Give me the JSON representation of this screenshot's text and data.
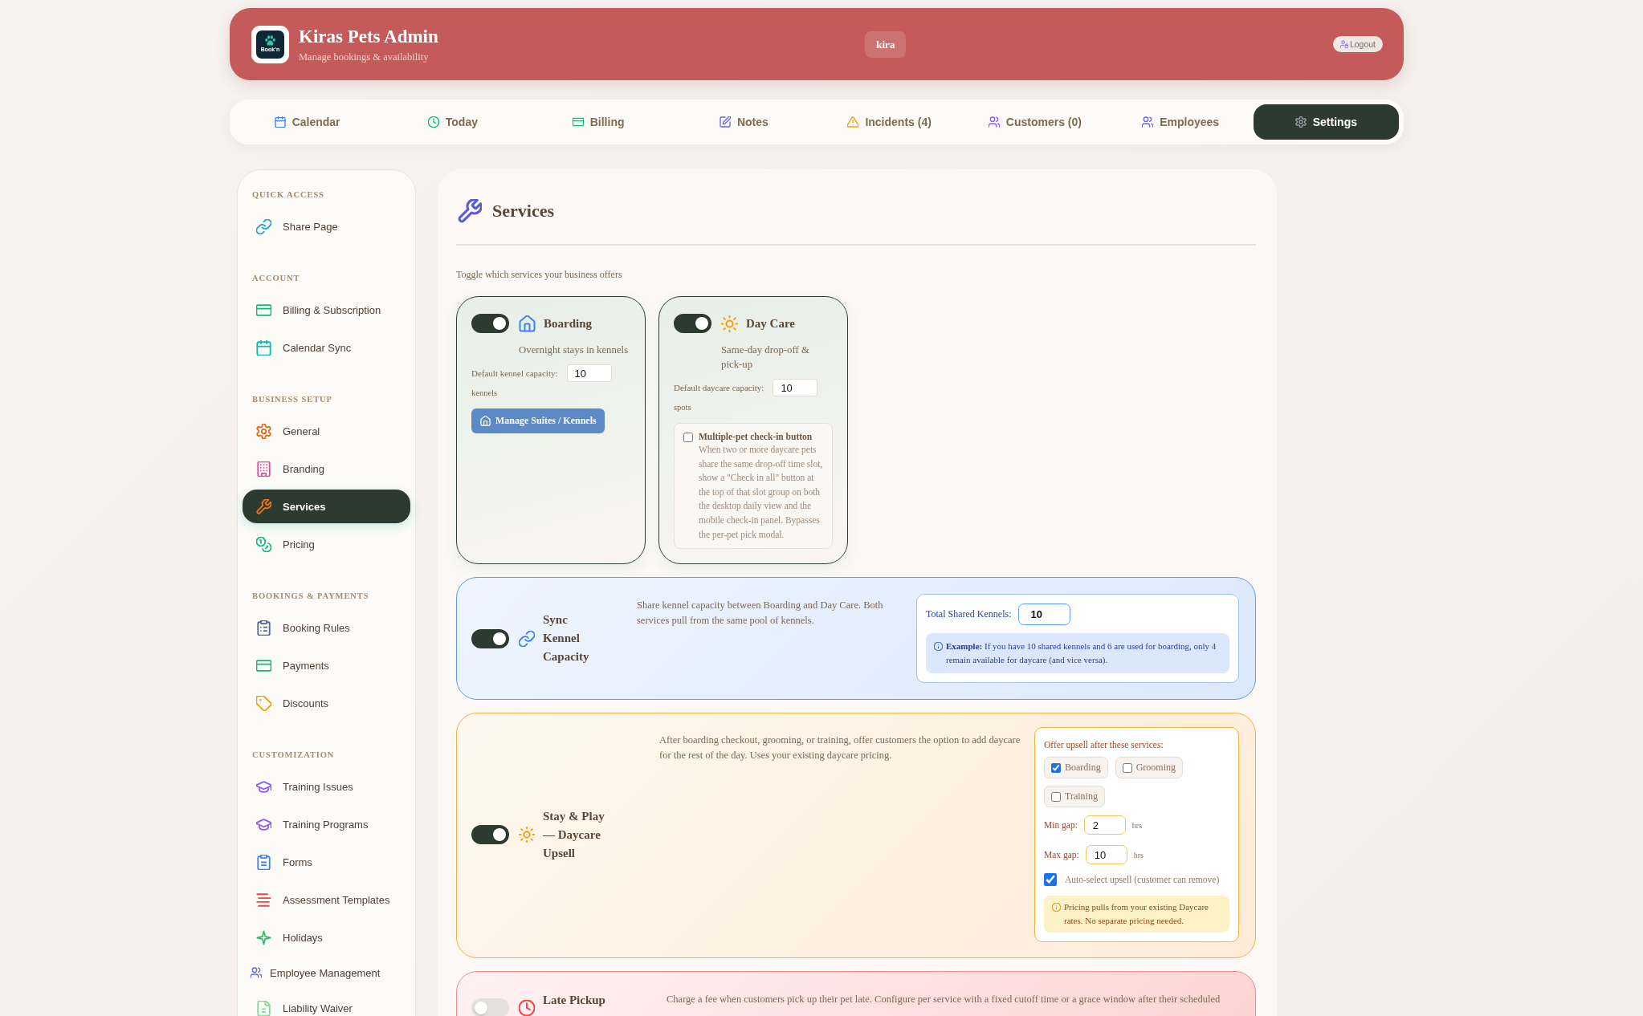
{
  "header": {
    "logo_text": "Book'n",
    "title": "Kiras Pets Admin",
    "subtitle": "Manage bookings & availability",
    "user": "kira",
    "logout": "Logout"
  },
  "nav": [
    {
      "label": "Calendar",
      "selected": false
    },
    {
      "label": "Today",
      "selected": false
    },
    {
      "label": "Billing",
      "selected": false
    },
    {
      "label": "Notes",
      "selected": false
    },
    {
      "label": "Incidents (4)",
      "selected": false
    },
    {
      "label": "Customers (0)",
      "selected": false
    },
    {
      "label": "Employees",
      "selected": false
    },
    {
      "label": "Settings",
      "selected": true
    }
  ],
  "sidebar": {
    "sections": [
      {
        "heading": "QUICK ACCESS",
        "items": [
          {
            "label": "Share Page",
            "kind": "link",
            "selected": false
          }
        ]
      },
      {
        "heading": "ACCOUNT",
        "items": [
          {
            "label": "Billing & Subscription",
            "kind": "link",
            "selected": false
          },
          {
            "label": "Calendar Sync",
            "kind": "link",
            "selected": false
          }
        ]
      },
      {
        "heading": "BUSINESS SETUP",
        "items": [
          {
            "label": "General",
            "kind": "link",
            "selected": false
          },
          {
            "label": "Branding",
            "kind": "link",
            "selected": false
          },
          {
            "label": "Services",
            "kind": "link",
            "selected": true
          },
          {
            "label": "Pricing",
            "kind": "link",
            "selected": false
          }
        ]
      },
      {
        "heading": "BOOKINGS & PAYMENTS",
        "items": [
          {
            "label": "Booking Rules",
            "kind": "link",
            "selected": false
          },
          {
            "label": "Payments",
            "kind": "link",
            "selected": false
          },
          {
            "label": "Discounts",
            "kind": "link",
            "selected": false
          }
        ]
      },
      {
        "heading": "CUSTOMIZATION",
        "items": [
          {
            "label": "Training Issues",
            "kind": "link",
            "selected": false
          },
          {
            "label": "Training Programs",
            "kind": "link",
            "selected": false
          },
          {
            "label": "Forms",
            "kind": "link",
            "selected": false
          },
          {
            "label": "Assessment Templates",
            "kind": "link",
            "selected": false
          },
          {
            "label": "Holidays",
            "kind": "link",
            "selected": false
          },
          {
            "label": "Employee Management",
            "kind": "compact",
            "selected": false
          },
          {
            "label": "Liability Waiver",
            "kind": "link",
            "selected": false
          }
        ]
      }
    ]
  },
  "main": {
    "title": "Services",
    "subtitle": "Toggle which services your business offers",
    "tiles": [
      {
        "title": "Boarding",
        "on": true,
        "description": "Overnight stays in kennels",
        "capacity_label": "Default kennel capacity:",
        "capacity_value": "10",
        "unit": "kennels",
        "button": "Manage Suites / Kennels"
      },
      {
        "title": "Day Care",
        "on": true,
        "description": "Same-day drop-off & pick-up",
        "capacity_label": "Default daycare capacity:",
        "capacity_value": "10",
        "unit": "spots",
        "option": {
          "label": "Multiple-pet check-in button",
          "checked": false,
          "description": "When two or more daycare pets share the same drop-off time slot, show a \"Check in all\" button at the top of that slot group on both the desktop daily view and the mobile check-in panel. Bypasses the per-pet pick modal."
        }
      }
    ],
    "cards": [
      {
        "kind": "sync",
        "title": "Sync Kennel Capacity",
        "on": true,
        "description": "Share kennel capacity between Boarding and Day Care. Both services pull from the same pool of kennels.",
        "panel": {
          "label": "Total Shared Kennels:",
          "value": "10",
          "note": "**Example:** If you have 10 shared kennels and 6 are used for boarding, only 4 remain available for daycare (and vice versa)."
        }
      },
      {
        "kind": "upsell",
        "title": "Stay & Play — Daycare Upsell",
        "on": true,
        "description": "After boarding checkout, grooming, or training, offer customers the option to add daycare for the rest of the day. Uses your existing daycare pricing.",
        "panel": {
          "heading": "Offer upsell after these services:",
          "services": [
            {
              "label": "Boarding",
              "checked": true
            },
            {
              "label": "Grooming",
              "checked": false
            },
            {
              "label": "Training",
              "checked": false
            }
          ],
          "gaps": [
            {
              "label": "Min gap:",
              "value": "2",
              "unit": "hrs"
            },
            {
              "label": "Max gap:",
              "value": "10",
              "unit": "hrs"
            }
          ],
          "auto_select": {
            "label": "Auto-select upsell (customer can remove)",
            "checked": true
          },
          "note": "Pricing pulls from your existing Daycare rates. No separate pricing needed."
        }
      },
      {
        "kind": "fee",
        "title": "Late Pickup",
        "on": false,
        "description": "Charge a fee when customers pick up their pet late. Configure per service with a fixed cutoff time or a grace window after their scheduled"
      }
    ]
  }
}
